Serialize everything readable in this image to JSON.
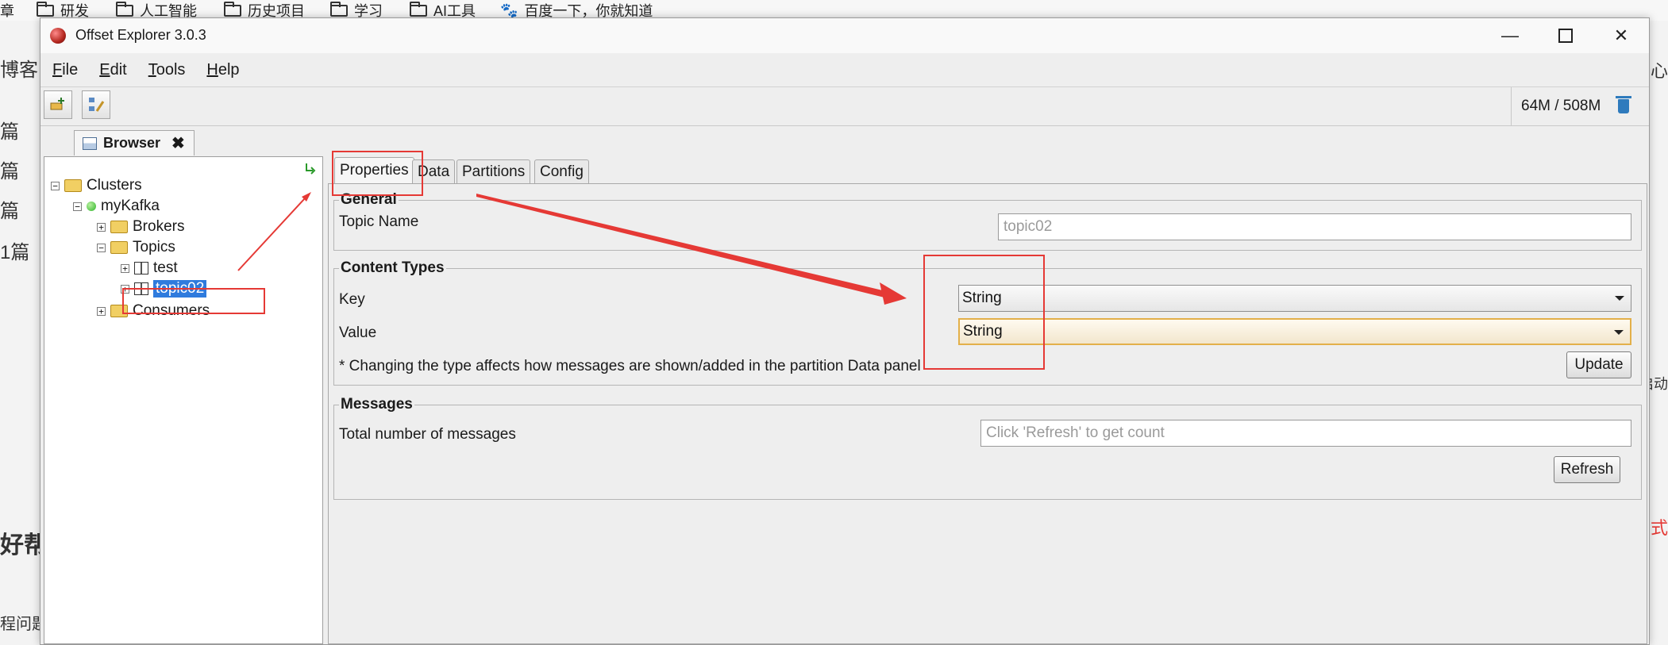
{
  "bookmarks": {
    "items": [
      {
        "label": "章",
        "icon": "none"
      },
      {
        "label": "研发",
        "icon": "folder-icon"
      },
      {
        "label": "人工智能",
        "icon": "folder-icon"
      },
      {
        "label": "历史项目",
        "icon": "folder-icon"
      },
      {
        "label": "学习",
        "icon": "folder-icon"
      },
      {
        "label": "AI工具",
        "icon": "folder-icon"
      },
      {
        "label": "百度一下，你就知道",
        "icon": "baidu-paw-icon"
      }
    ]
  },
  "background": {
    "left_texts": [
      "博客",
      "篇",
      "篇",
      "篇",
      "1篇",
      "好帮",
      "程问题"
    ],
    "right_texts": [
      "心",
      "启动",
      "式"
    ]
  },
  "window": {
    "title": "Offset Explorer  3.0.3",
    "controls": [
      "minimize",
      "maximize",
      "close"
    ]
  },
  "menu": {
    "items": [
      {
        "mnemonic": "F",
        "rest": "ile"
      },
      {
        "mnemonic": "E",
        "rest": "dit"
      },
      {
        "mnemonic": "T",
        "rest": "ools"
      },
      {
        "mnemonic": "H",
        "rest": "elp"
      }
    ]
  },
  "toolbar": {
    "buttons": [
      "add-cluster-icon",
      "edit-cluster-icon"
    ],
    "memory": "64M / 508M",
    "gc_icon": "trash-icon"
  },
  "browser_tab": {
    "label": "Browser",
    "close": "✖"
  },
  "tree": {
    "root": "Clusters",
    "cluster": "myKafka",
    "brokers": "Brokers",
    "topics": "Topics",
    "topic_items": [
      "test",
      "topic02"
    ],
    "selected": "topic02",
    "consumers": "Consumers",
    "refresh_icon": "arrow-down-right-icon"
  },
  "detail_tabs": {
    "items": [
      "Properties",
      "Data",
      "Partitions",
      "Config"
    ],
    "active": "Properties"
  },
  "general": {
    "title": "General",
    "topic_name_label": "Topic Name",
    "topic_name_value": "topic02"
  },
  "content_types": {
    "title": "Content Types",
    "key_label": "Key",
    "key_value": "String",
    "value_label": "Value",
    "value_value": "String",
    "note": "* Changing the type affects how messages are shown/added in the partition Data panel",
    "update_button": "Update"
  },
  "messages": {
    "title": "Messages",
    "total_label": "Total number of messages",
    "total_placeholder": "Click 'Refresh' to get count",
    "refresh_button": "Refresh"
  },
  "colors": {
    "annotation": "#e53935",
    "selection": "#2f7bdd",
    "focus_border": "#e3b04a"
  }
}
